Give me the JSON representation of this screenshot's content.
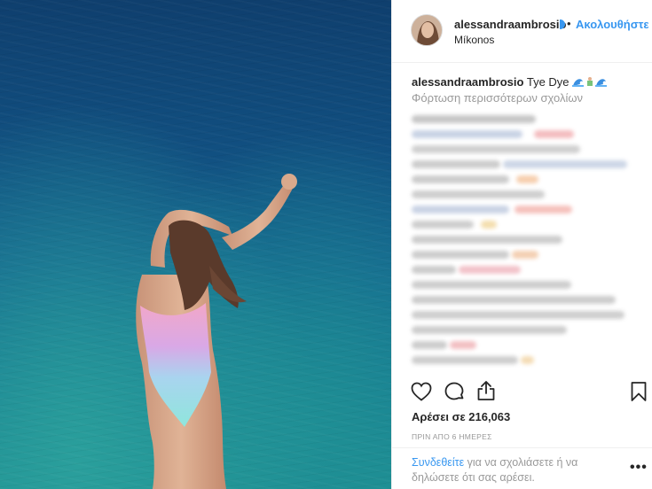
{
  "post": {
    "username": "alessandraambrosio",
    "follow_label": "Ακολουθήστε",
    "dot": "•",
    "location": "Míkonos",
    "caption_user": "alessandraambrosio",
    "caption_text": "Tye Dye",
    "load_more": "Φόρτωση περισσότερων σχολίων",
    "likes": "Αρέσει σε 216,063",
    "time": "ΠΡΙΝ ΑΠΟ 6 ΗΜΕΡΕΣ",
    "login_link": "Συνδεθείτε",
    "login_text": " για να σχολιάσετε ή να δηλώσετε ότι σας αρέσει.",
    "more_label": "•••"
  },
  "icons": {
    "like": "heart-icon",
    "comment": "comment-icon",
    "share": "share-icon",
    "save": "bookmark-icon",
    "verified": "verified-badge-icon",
    "caption_emoji": "wave-emoji-icons"
  },
  "colors": {
    "link": "#3897f0",
    "text": "#262626",
    "muted": "#999999",
    "border": "#efefef"
  }
}
